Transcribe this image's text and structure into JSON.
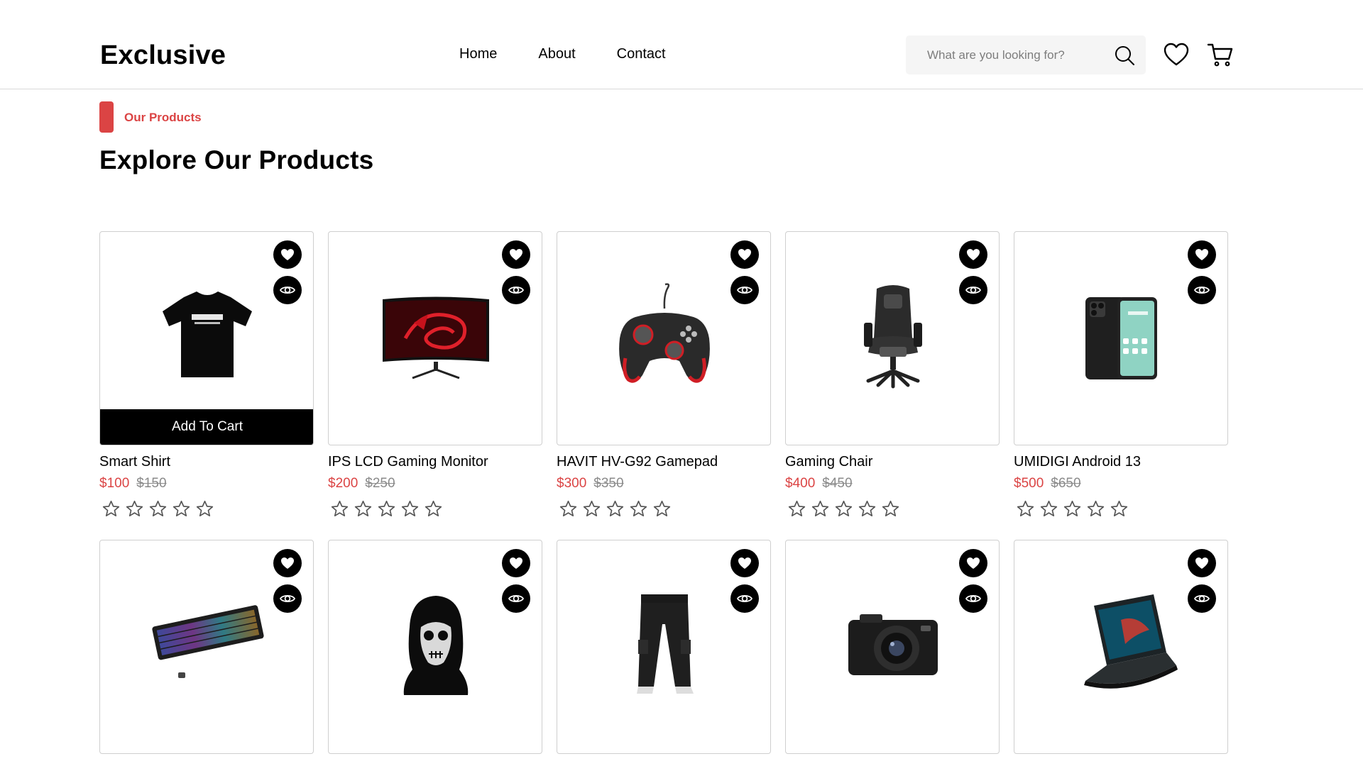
{
  "header": {
    "logo": "Exclusive",
    "nav": [
      "Home",
      "About",
      "Contact"
    ],
    "search_placeholder": "What are you looking for?"
  },
  "section": {
    "tag": "Our Products",
    "title": "Explore Our Products",
    "accent_color": "#db4444"
  },
  "add_to_cart_label": "Add To Cart",
  "icons": {
    "search": "search-icon",
    "wishlist": "heart-icon",
    "cart": "cart-icon",
    "card_favorite": "heart-icon",
    "card_view": "eye-icon",
    "rating": "star-outline-icon"
  },
  "products": [
    {
      "name": "Smart Shirt",
      "price": "$100",
      "old_price": "$150",
      "rating": 0,
      "image": "t-shirt",
      "show_add_to_cart": true
    },
    {
      "name": "IPS LCD Gaming Monitor",
      "price": "$200",
      "old_price": "$250",
      "rating": 0,
      "image": "monitor"
    },
    {
      "name": "HAVIT HV-G92 Gamepad",
      "price": "$300",
      "old_price": "$350",
      "rating": 0,
      "image": "gamepad"
    },
    {
      "name": "Gaming Chair",
      "price": "$400",
      "old_price": "$450",
      "rating": 0,
      "image": "gaming-chair"
    },
    {
      "name": "UMIDIGI Android 13",
      "price": "$500",
      "old_price": "$650",
      "rating": 0,
      "image": "smartphone"
    },
    {
      "image": "keyboard"
    },
    {
      "image": "balaclava-mask"
    },
    {
      "image": "cargo-pants"
    },
    {
      "image": "camera"
    },
    {
      "image": "laptop"
    }
  ]
}
